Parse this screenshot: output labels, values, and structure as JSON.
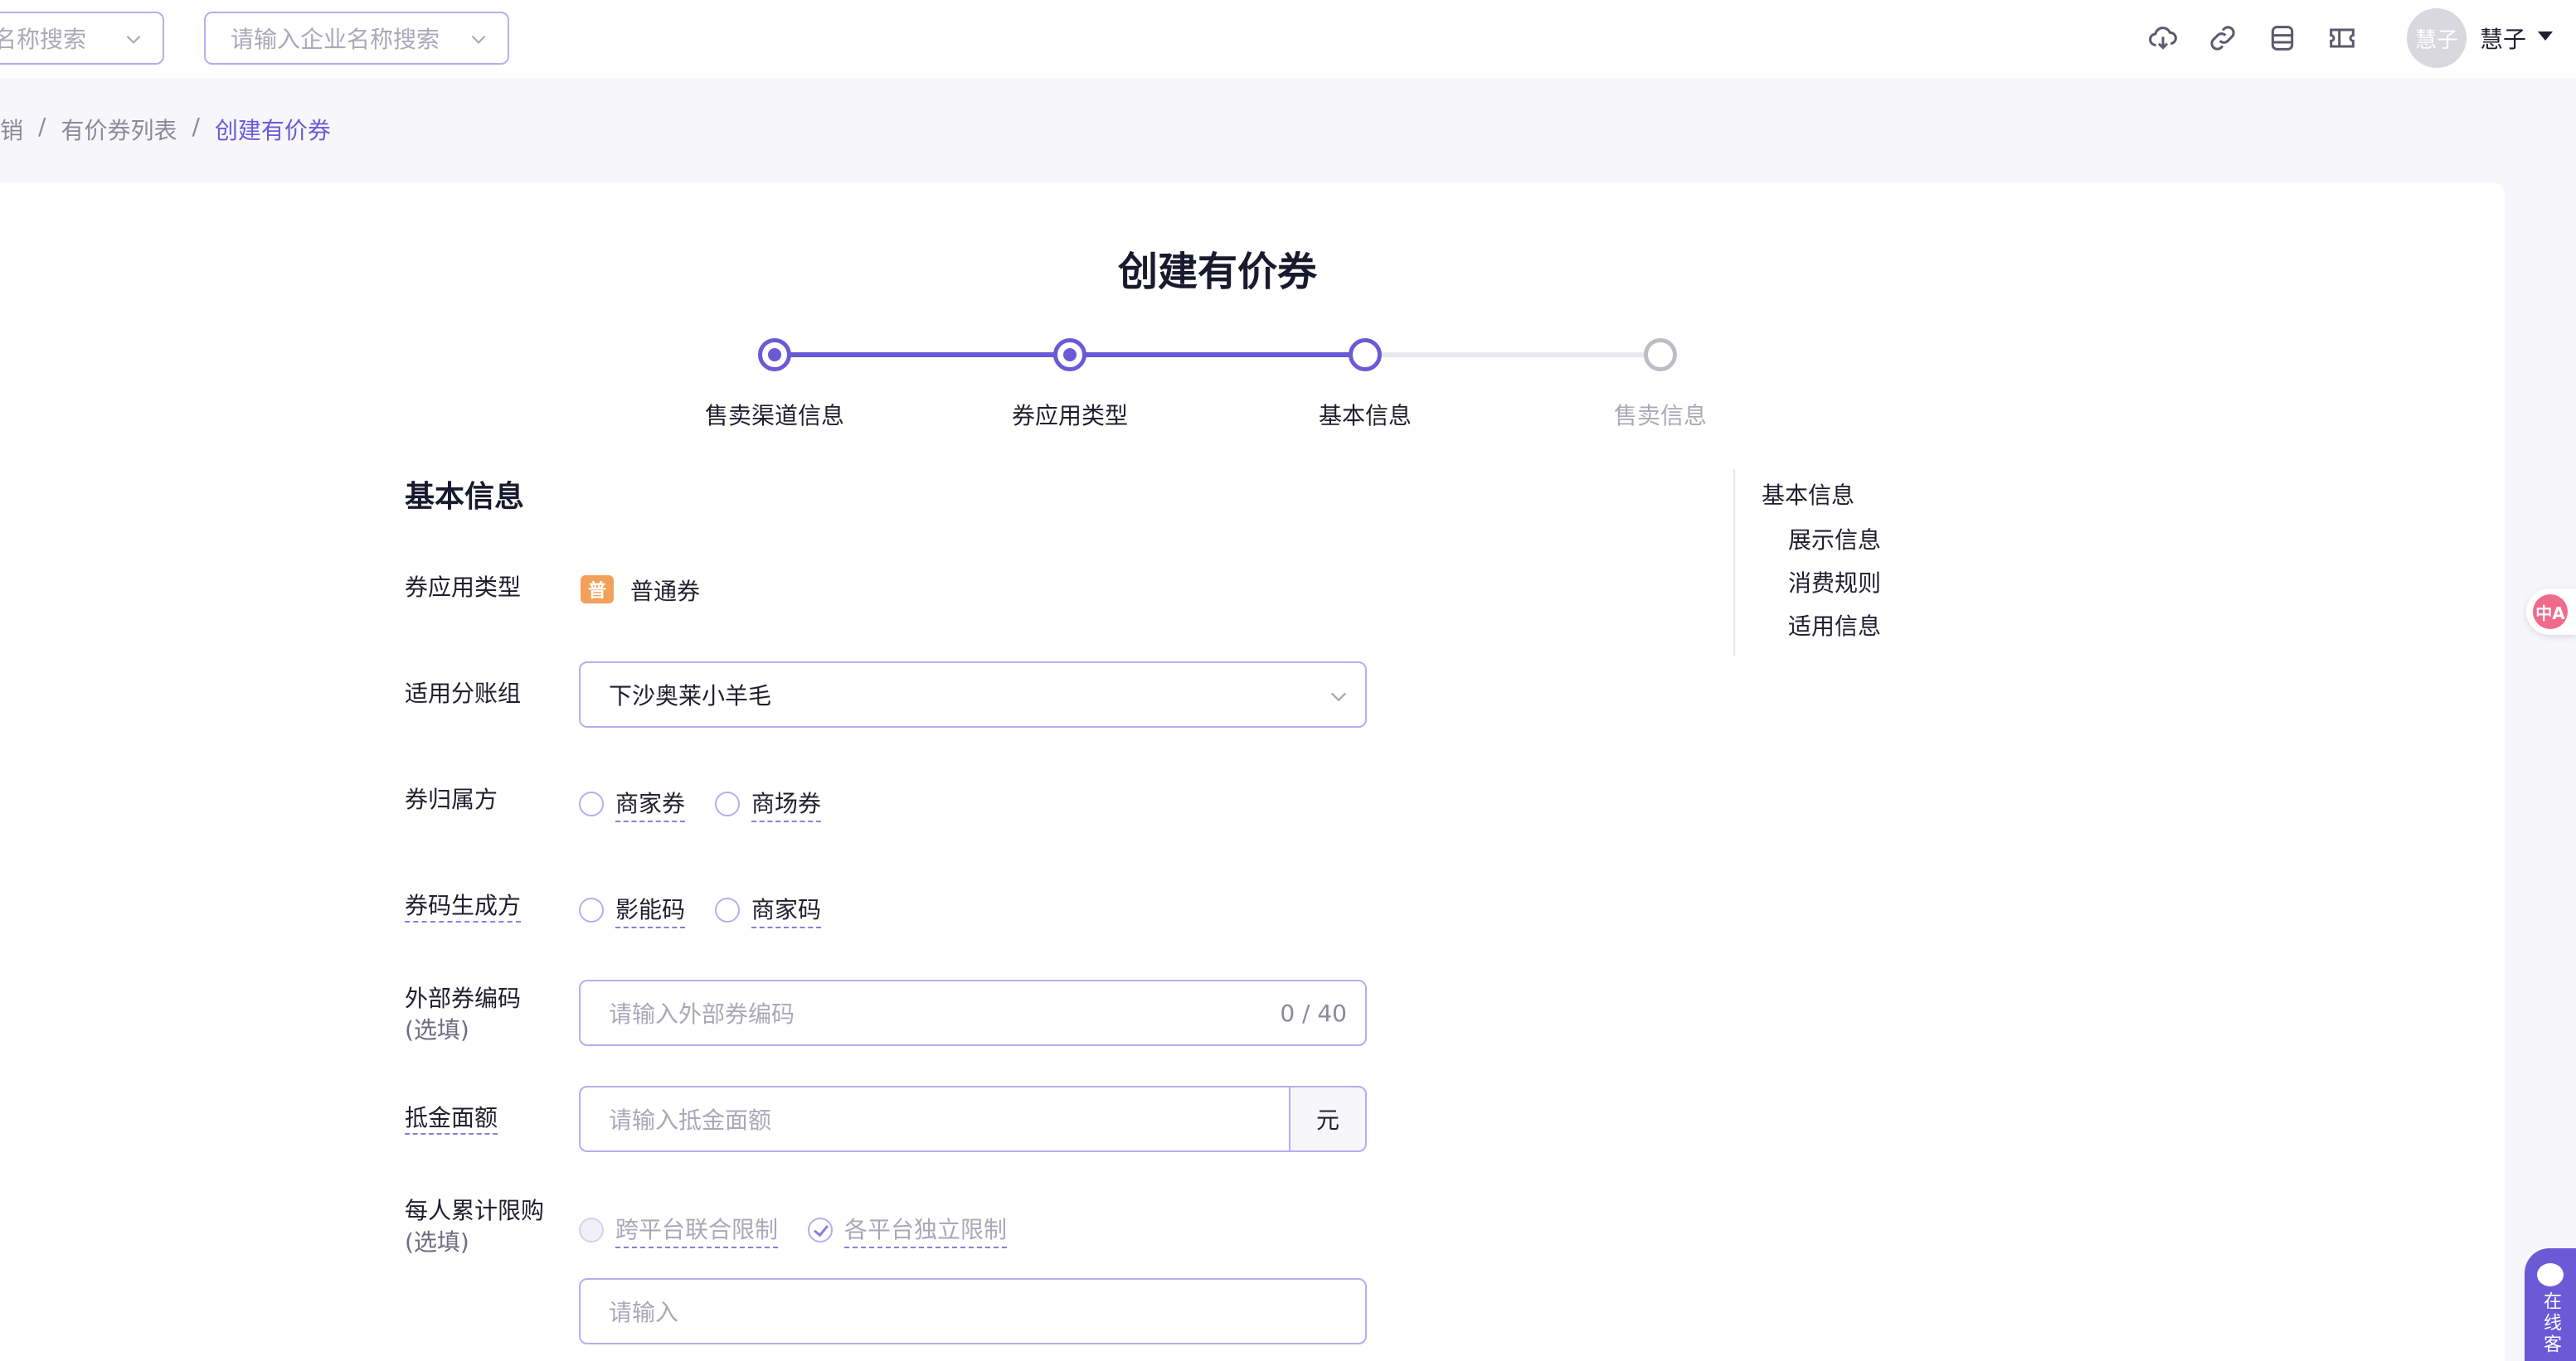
{
  "topbar": {
    "search1_placeholder": "名称搜索",
    "search2_placeholder": "请输入企业名称搜索",
    "avatar_text": "慧子",
    "username": "慧子"
  },
  "breadcrumb": {
    "item1": "销",
    "item2": "有价券列表",
    "item3": "创建有价券",
    "separator": "/"
  },
  "page": {
    "title": "创建有价券",
    "accent_color": "#6a5ad6"
  },
  "steps": [
    {
      "label": "售卖渠道信息",
      "status": "done"
    },
    {
      "label": "券应用类型",
      "status": "done"
    },
    {
      "label": "基本信息",
      "status": "current"
    },
    {
      "label": "售卖信息",
      "status": "pending"
    }
  ],
  "section": {
    "title": "基本信息"
  },
  "anchors": {
    "root": "基本信息",
    "items": [
      "展示信息",
      "消费规则",
      "适用信息"
    ]
  },
  "form": {
    "coupon_type": {
      "label": "券应用类型",
      "badge": "普",
      "value": "普通券"
    },
    "account_group": {
      "label": "适用分账组",
      "value": "下沙奥莱小羊毛"
    },
    "owner": {
      "label": "券归属方",
      "options": [
        "商家券",
        "商场券"
      ]
    },
    "code_generator": {
      "label": "券码生成方",
      "options": [
        "影能码",
        "商家码"
      ]
    },
    "external_code": {
      "label": "外部券编码",
      "optional": "(选填)",
      "placeholder": "请输入外部券编码",
      "counter": "0 / 40"
    },
    "amount": {
      "label": "抵金面额",
      "placeholder": "请输入抵金面额",
      "unit": "元"
    },
    "purchase_limit": {
      "label": "每人累计限购",
      "optional": "(选填)",
      "options": [
        "跨平台联合限制",
        "各平台独立限制"
      ],
      "checked": "各平台独立限制",
      "placeholder": "请输入"
    }
  },
  "floating": {
    "translate_text": "中A",
    "service_text": "在线客"
  }
}
